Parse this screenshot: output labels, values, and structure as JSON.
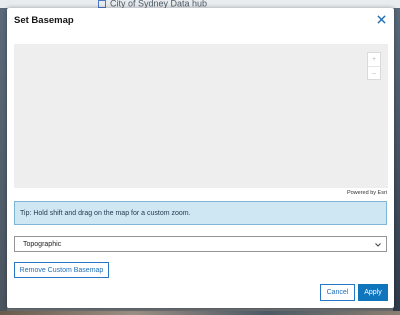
{
  "background": {
    "page_title": "City of Sydney Data hub"
  },
  "dialog": {
    "title": "Set Basemap",
    "close_icon": "close-icon",
    "map": {
      "zoom_in_label": "+",
      "zoom_out_label": "–",
      "attribution": "Powered by Esri"
    },
    "tip": "Tip: Hold shift and drag on the map for a custom zoom.",
    "basemap_select": {
      "value": "Topographic"
    },
    "remove_button": "Remove Custom Basemap",
    "cancel_button": "Cancel",
    "apply_button": "Apply"
  },
  "colors": {
    "accent": "#0f75bd",
    "tip_background": "#cfe6f3",
    "map_placeholder": "#eeeeee"
  }
}
